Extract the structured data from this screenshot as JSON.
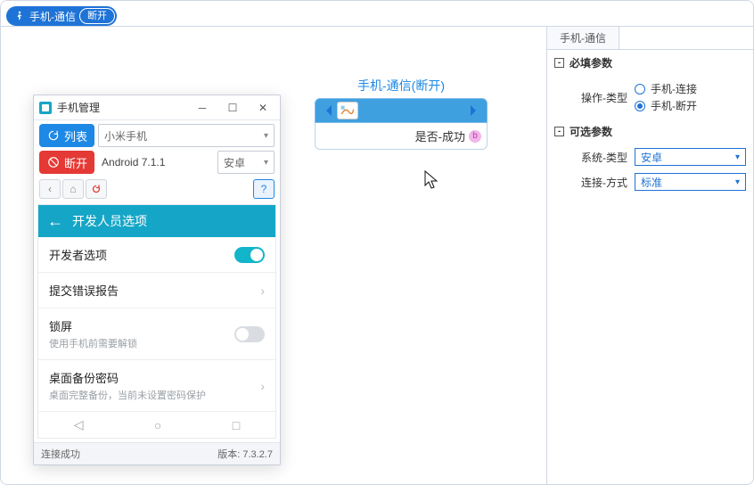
{
  "ribbon": {
    "tab_label": "手机-通信",
    "tab_badge": "断开"
  },
  "node": {
    "title": "手机-通信(断开)",
    "output_label": "是否-成功",
    "output_pin": "b"
  },
  "inspector": {
    "tab": "手机-通信",
    "required_header": "必填参数",
    "optional_header": "可选参数",
    "op_type_label": "操作-类型",
    "op_type_options": {
      "connect": "手机-连接",
      "disconnect": "手机-断开"
    },
    "sys_type_label": "系统-类型",
    "sys_type_value": "安卓",
    "conn_mode_label": "连接-方式",
    "conn_mode_value": "标准"
  },
  "win": {
    "title": "手机管理",
    "list_btn": "列表",
    "disconnect_btn": "断开",
    "device_value": "小米手机",
    "android_label": "Android 7.1.1",
    "platform_value": "安卓",
    "status": "连接成功",
    "version_label": "版本: 7.3.2.7"
  },
  "phone": {
    "header": "开发人员选项",
    "items": [
      {
        "title": "开发者选项",
        "sub": "",
        "ctrl": "switch-on"
      },
      {
        "title": "提交错误报告",
        "sub": "",
        "ctrl": "chev"
      },
      {
        "title": "锁屏",
        "sub": "使用手机前需要解锁",
        "ctrl": "switch-off"
      },
      {
        "title": "桌面备份密码",
        "sub": "桌面完整备份，当前未设置密码保护",
        "ctrl": "chev"
      }
    ]
  }
}
